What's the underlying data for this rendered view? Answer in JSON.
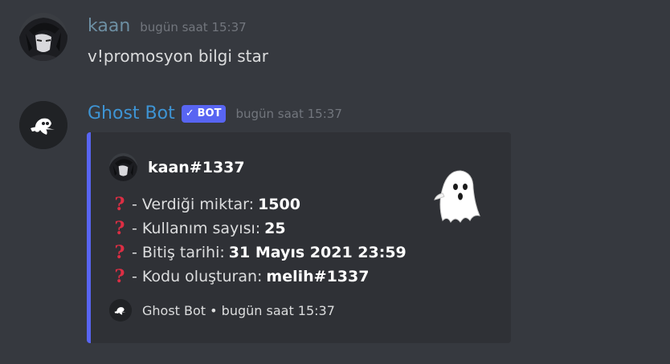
{
  "messages": [
    {
      "author": "kaan",
      "timestamp": "bugün saat 15:37",
      "content": "v!promosyon bilgi star",
      "avatar_icon": "anime-avatar-icon"
    },
    {
      "author": "Ghost Bot",
      "bot_tag": "BOT",
      "bot_tag_icon": "verified-check-icon",
      "timestamp": "bugün saat 15:37",
      "avatar_icon": "ghost-bot-logo-icon",
      "embed": {
        "accent_color": "#5865f2",
        "author_name": "kaan#1337",
        "thumbnail_icon": "ghost-icon",
        "field_icon": "question-mark-icon",
        "fields": [
          {
            "label": "- Verdiği miktar:",
            "value": "1500"
          },
          {
            "label": "- Kullanım sayısı:",
            "value": "25"
          },
          {
            "label": "- Bitiş tarihi:",
            "value": "31 Mayıs 2021 23:59"
          },
          {
            "label": "- Kodu oluşturan:",
            "value": "melih#1337"
          }
        ],
        "footer_text": "Ghost Bot • bugün saat 15:37"
      }
    }
  ],
  "colors": {
    "background": "#36393f",
    "embed_background": "#2f3136",
    "username_kaan": "#6d8fa3",
    "username_bot": "#3e94d4",
    "bot_tag": "#5865f2",
    "question_mark": "#dd2e44"
  }
}
